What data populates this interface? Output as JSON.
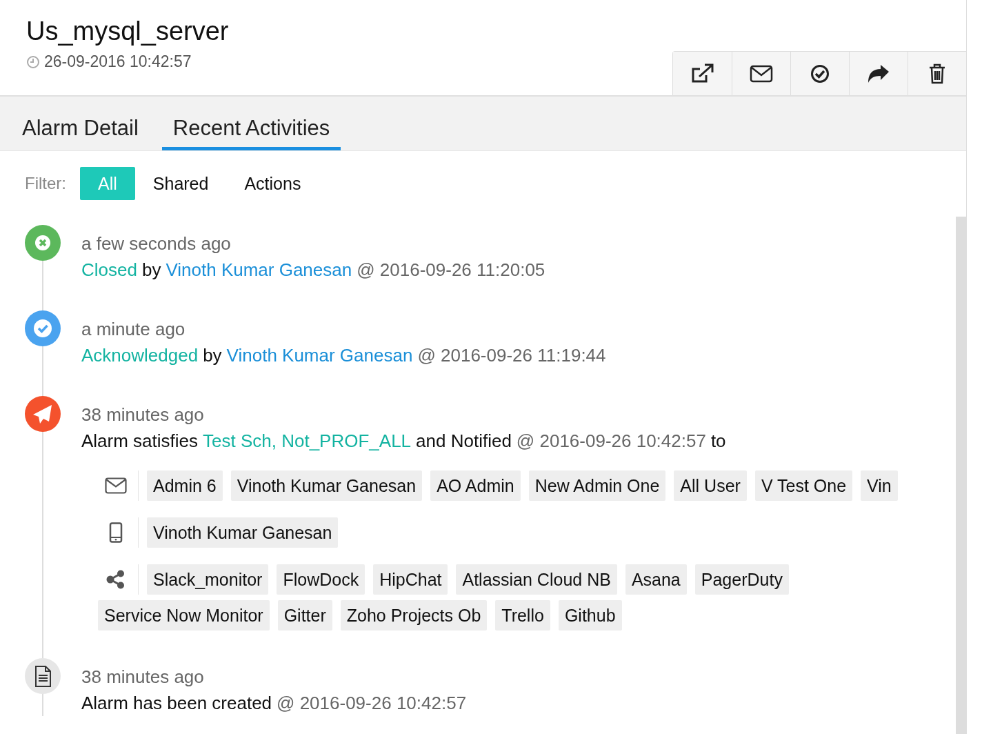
{
  "header": {
    "title": "Us_mysql_server",
    "timestamp": "26-09-2016 10:42:57"
  },
  "actions": [
    {
      "kind": "open-external"
    },
    {
      "kind": "email"
    },
    {
      "kind": "check"
    },
    {
      "kind": "share"
    },
    {
      "kind": "delete"
    }
  ],
  "tabs": [
    {
      "label": "Alarm Detail",
      "selected": false
    },
    {
      "label": "Recent Activities",
      "selected": true
    }
  ],
  "filter": {
    "label": "Filter:",
    "options": [
      {
        "label": "All",
        "selected": true
      },
      {
        "label": "Shared",
        "selected": false
      },
      {
        "label": "Actions",
        "selected": false
      }
    ]
  },
  "activities": [
    {
      "kind": "closed",
      "time": "a few seconds ago",
      "segments": [
        {
          "kind": "status",
          "text": "Closed"
        },
        {
          "kind": "plain",
          "text": "by"
        },
        {
          "kind": "user",
          "text": "Vinoth Kumar Ganesan"
        },
        {
          "kind": "meta",
          "text": "@ 2016-09-26 11:20:05"
        }
      ]
    },
    {
      "kind": "acknowledged",
      "time": "a minute ago",
      "segments": [
        {
          "kind": "status",
          "text": "Acknowledged"
        },
        {
          "kind": "plain",
          "text": "by"
        },
        {
          "kind": "user",
          "text": "Vinoth Kumar Ganesan"
        },
        {
          "kind": "meta",
          "text": "@ 2016-09-26 11:19:44"
        }
      ]
    },
    {
      "kind": "notified",
      "time": "38 minutes ago",
      "segments": [
        {
          "kind": "plain",
          "text": "Alarm satisfies"
        },
        {
          "kind": "status",
          "text": "Test Sch, Not_PROF_ALL"
        },
        {
          "kind": "plain",
          "text": "and Notified"
        },
        {
          "kind": "meta",
          "text": "@ 2016-09-26 10:42:57"
        },
        {
          "kind": "plain",
          "text": "to"
        }
      ],
      "notifications": [
        {
          "kind": "email",
          "recipients": [
            "Admin 6",
            "Vinoth Kumar Ganesan",
            "AO Admin",
            "New Admin One",
            "All User",
            "V Test One",
            "Vin"
          ]
        },
        {
          "kind": "phone",
          "recipients": [
            "Vinoth Kumar Ganesan"
          ]
        },
        {
          "kind": "share",
          "recipients": [
            "Slack_monitor",
            "FlowDock",
            "HipChat",
            "Atlassian Cloud NB",
            "Asana",
            "PagerDuty",
            "Service Now Monitor",
            "Gitter",
            "Zoho Projects Ob",
            "Trello",
            "Github"
          ]
        }
      ]
    },
    {
      "kind": "created",
      "time": "38 minutes ago",
      "segments": [
        {
          "kind": "plain",
          "text": "Alarm has been created"
        },
        {
          "kind": "meta",
          "text": "@ 2016-09-26 10:42:57"
        }
      ]
    }
  ]
}
